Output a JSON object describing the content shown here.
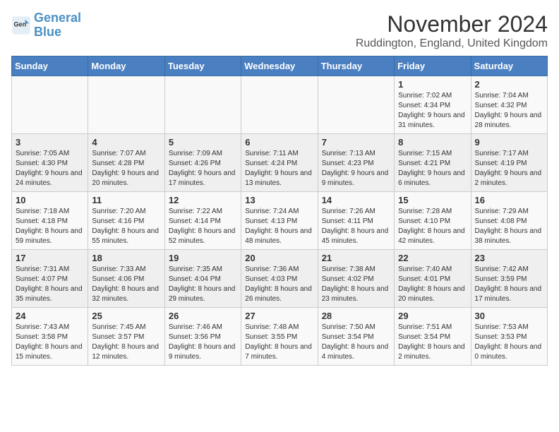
{
  "logo": {
    "line1": "General",
    "line2": "Blue"
  },
  "title": "November 2024",
  "location": "Ruddington, England, United Kingdom",
  "days_of_week": [
    "Sunday",
    "Monday",
    "Tuesday",
    "Wednesday",
    "Thursday",
    "Friday",
    "Saturday"
  ],
  "weeks": [
    [
      {
        "day": "",
        "info": ""
      },
      {
        "day": "",
        "info": ""
      },
      {
        "day": "",
        "info": ""
      },
      {
        "day": "",
        "info": ""
      },
      {
        "day": "",
        "info": ""
      },
      {
        "day": "1",
        "info": "Sunrise: 7:02 AM\nSunset: 4:34 PM\nDaylight: 9 hours and 31 minutes."
      },
      {
        "day": "2",
        "info": "Sunrise: 7:04 AM\nSunset: 4:32 PM\nDaylight: 9 hours and 28 minutes."
      }
    ],
    [
      {
        "day": "3",
        "info": "Sunrise: 7:05 AM\nSunset: 4:30 PM\nDaylight: 9 hours and 24 minutes."
      },
      {
        "day": "4",
        "info": "Sunrise: 7:07 AM\nSunset: 4:28 PM\nDaylight: 9 hours and 20 minutes."
      },
      {
        "day": "5",
        "info": "Sunrise: 7:09 AM\nSunset: 4:26 PM\nDaylight: 9 hours and 17 minutes."
      },
      {
        "day": "6",
        "info": "Sunrise: 7:11 AM\nSunset: 4:24 PM\nDaylight: 9 hours and 13 minutes."
      },
      {
        "day": "7",
        "info": "Sunrise: 7:13 AM\nSunset: 4:23 PM\nDaylight: 9 hours and 9 minutes."
      },
      {
        "day": "8",
        "info": "Sunrise: 7:15 AM\nSunset: 4:21 PM\nDaylight: 9 hours and 6 minutes."
      },
      {
        "day": "9",
        "info": "Sunrise: 7:17 AM\nSunset: 4:19 PM\nDaylight: 9 hours and 2 minutes."
      }
    ],
    [
      {
        "day": "10",
        "info": "Sunrise: 7:18 AM\nSunset: 4:18 PM\nDaylight: 8 hours and 59 minutes."
      },
      {
        "day": "11",
        "info": "Sunrise: 7:20 AM\nSunset: 4:16 PM\nDaylight: 8 hours and 55 minutes."
      },
      {
        "day": "12",
        "info": "Sunrise: 7:22 AM\nSunset: 4:14 PM\nDaylight: 8 hours and 52 minutes."
      },
      {
        "day": "13",
        "info": "Sunrise: 7:24 AM\nSunset: 4:13 PM\nDaylight: 8 hours and 48 minutes."
      },
      {
        "day": "14",
        "info": "Sunrise: 7:26 AM\nSunset: 4:11 PM\nDaylight: 8 hours and 45 minutes."
      },
      {
        "day": "15",
        "info": "Sunrise: 7:28 AM\nSunset: 4:10 PM\nDaylight: 8 hours and 42 minutes."
      },
      {
        "day": "16",
        "info": "Sunrise: 7:29 AM\nSunset: 4:08 PM\nDaylight: 8 hours and 38 minutes."
      }
    ],
    [
      {
        "day": "17",
        "info": "Sunrise: 7:31 AM\nSunset: 4:07 PM\nDaylight: 8 hours and 35 minutes."
      },
      {
        "day": "18",
        "info": "Sunrise: 7:33 AM\nSunset: 4:06 PM\nDaylight: 8 hours and 32 minutes."
      },
      {
        "day": "19",
        "info": "Sunrise: 7:35 AM\nSunset: 4:04 PM\nDaylight: 8 hours and 29 minutes."
      },
      {
        "day": "20",
        "info": "Sunrise: 7:36 AM\nSunset: 4:03 PM\nDaylight: 8 hours and 26 minutes."
      },
      {
        "day": "21",
        "info": "Sunrise: 7:38 AM\nSunset: 4:02 PM\nDaylight: 8 hours and 23 minutes."
      },
      {
        "day": "22",
        "info": "Sunrise: 7:40 AM\nSunset: 4:01 PM\nDaylight: 8 hours and 20 minutes."
      },
      {
        "day": "23",
        "info": "Sunrise: 7:42 AM\nSunset: 3:59 PM\nDaylight: 8 hours and 17 minutes."
      }
    ],
    [
      {
        "day": "24",
        "info": "Sunrise: 7:43 AM\nSunset: 3:58 PM\nDaylight: 8 hours and 15 minutes."
      },
      {
        "day": "25",
        "info": "Sunrise: 7:45 AM\nSunset: 3:57 PM\nDaylight: 8 hours and 12 minutes."
      },
      {
        "day": "26",
        "info": "Sunrise: 7:46 AM\nSunset: 3:56 PM\nDaylight: 8 hours and 9 minutes."
      },
      {
        "day": "27",
        "info": "Sunrise: 7:48 AM\nSunset: 3:55 PM\nDaylight: 8 hours and 7 minutes."
      },
      {
        "day": "28",
        "info": "Sunrise: 7:50 AM\nSunset: 3:54 PM\nDaylight: 8 hours and 4 minutes."
      },
      {
        "day": "29",
        "info": "Sunrise: 7:51 AM\nSunset: 3:54 PM\nDaylight: 8 hours and 2 minutes."
      },
      {
        "day": "30",
        "info": "Sunrise: 7:53 AM\nSunset: 3:53 PM\nDaylight: 8 hours and 0 minutes."
      }
    ]
  ]
}
